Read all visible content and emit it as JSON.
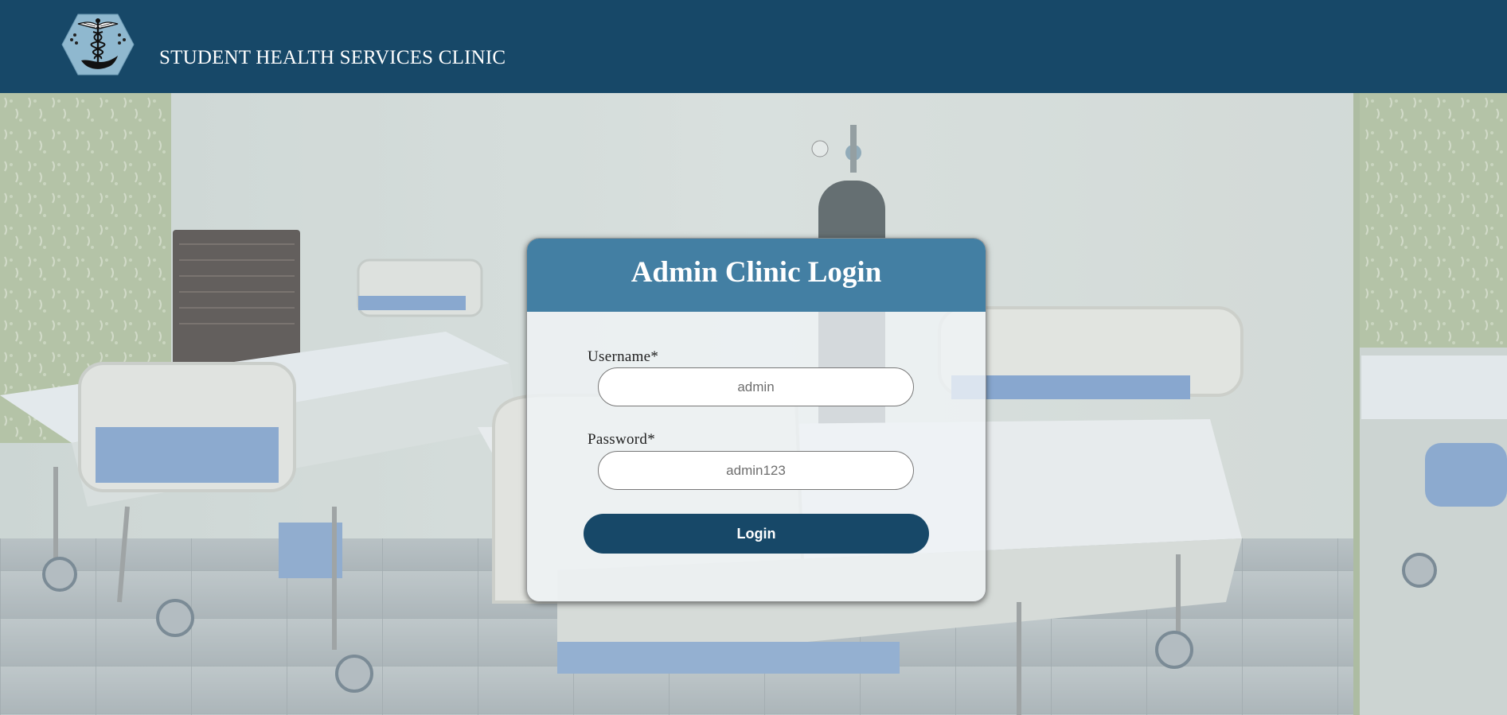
{
  "header": {
    "clinic_name": "STUDENT HEALTH SERVICES CLINIC"
  },
  "login": {
    "title": "Admin Clinic Login",
    "username_label": "Username*",
    "username_placeholder": "admin",
    "password_label": "Password*",
    "password_placeholder": "admin123",
    "submit_label": "Login"
  },
  "colors": {
    "header_bg": "#174868",
    "card_header_bg": "#437fa3",
    "button_bg": "#174868"
  }
}
